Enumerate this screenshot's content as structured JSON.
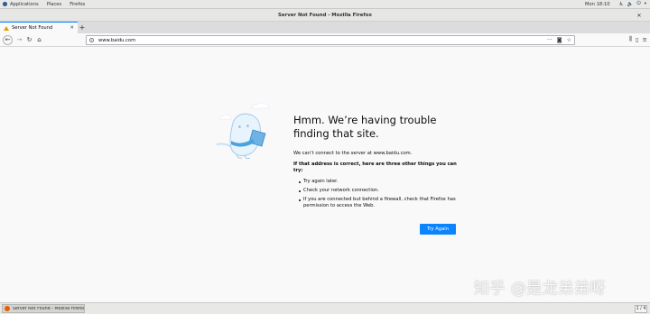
{
  "topbar": {
    "menu": [
      "Applications",
      "Places",
      "Firefox"
    ],
    "clock": "Mon 18:10"
  },
  "window": {
    "title": "Server Not Found - Mozilla Firefox"
  },
  "tab": {
    "label": "Server Not Found"
  },
  "urlbar": {
    "url": "www.baidu.com"
  },
  "error": {
    "title": "Hmm. We’re having trouble finding that site.",
    "message": "We can’t connect to the server at www.baidu.com.",
    "suggestion_heading": "If that address is correct, here are three other things you can try:",
    "suggestions": [
      "Try again later.",
      "Check your network connection.",
      "If you are connected but behind a firewall, check that Firefox has permission to access the Web."
    ],
    "button": "Try Again"
  },
  "watermark": "知乎 @是龙弟弟呀",
  "taskbar": {
    "item": "Server Not Found - Mozilla Firefox",
    "pager": "1 / 4"
  },
  "colors": {
    "accent": "#0a84ff",
    "warning": "#d7a400"
  }
}
